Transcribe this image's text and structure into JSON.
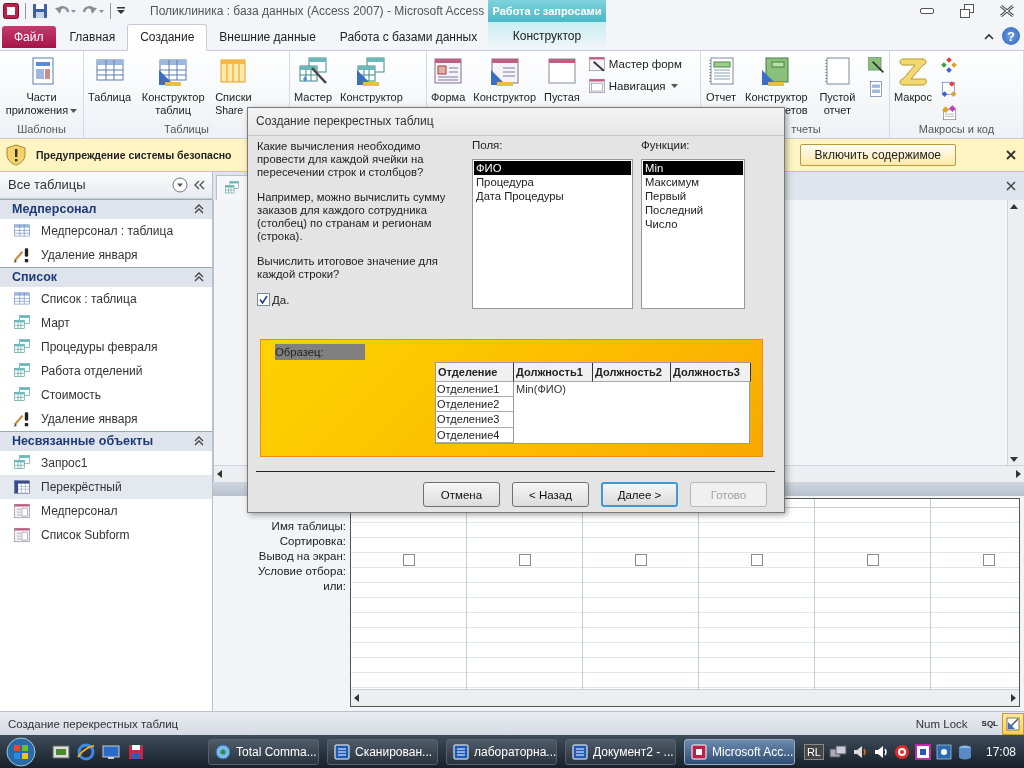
{
  "window": {
    "title": "Поликлиника : база данных (Access 2007)  -  Microsoft Access",
    "context_group": "Работа с запросами"
  },
  "ribbon_tabs": [
    {
      "label": "Файл",
      "kind": "file",
      "selected": false
    },
    {
      "label": "Главная",
      "kind": "tab",
      "selected": false
    },
    {
      "label": "Создание",
      "kind": "tab",
      "selected": true
    },
    {
      "label": "Внешние данные",
      "kind": "tab",
      "selected": false
    },
    {
      "label": "Работа с базами данных",
      "kind": "tab",
      "selected": false
    },
    {
      "label": "Конструктор",
      "kind": "context",
      "selected": false
    }
  ],
  "help": "?",
  "ribbon_groups": [
    {
      "label": "Шаблоны",
      "items": [
        {
          "kind": "large",
          "label": "Части приложения",
          "dropdown": true
        }
      ]
    },
    {
      "label": "Таблицы",
      "items": [
        {
          "kind": "large",
          "label": "Таблица"
        },
        {
          "kind": "large",
          "label": "Конструктор таблиц"
        },
        {
          "kind": "large",
          "label": "Списки",
          "label_line2": "Share"
        }
      ]
    },
    {
      "items": [
        {
          "kind": "large",
          "label": "Мастер"
        },
        {
          "kind": "large",
          "label": "Конструктор"
        }
      ]
    },
    {
      "items": [
        {
          "kind": "large",
          "label": "Форма"
        },
        {
          "kind": "large",
          "label": "Конструктор"
        },
        {
          "kind": "large",
          "label": "Пустая"
        },
        {
          "kind": "stack",
          "items": [
            {
              "label": "Мастер форм"
            },
            {
              "label": "Навигация",
              "dropdown": true
            }
          ]
        }
      ]
    },
    {
      "label": "тчеты",
      "items": [
        {
          "kind": "large",
          "label": "Отчет"
        },
        {
          "kind": "large",
          "label": "Конструктор",
          "label_line2": "етов"
        },
        {
          "kind": "large",
          "label": "Пустой отчет"
        },
        {
          "kind": "icons"
        }
      ]
    },
    {
      "label": "Макросы и код",
      "items": [
        {
          "kind": "large",
          "label": "Макрос"
        },
        {
          "kind": "icons"
        }
      ]
    }
  ],
  "warning": {
    "text": "Предупреждение системы безопасно",
    "button": "Включить содержимое"
  },
  "navigation": {
    "title": "Все таблицы",
    "groups": [
      {
        "label": "Медперсонал",
        "expanded": true,
        "items": [
          {
            "label": "Медперсонал : таблица",
            "kind": "table",
            "selected": false
          },
          {
            "label": "Удаление января",
            "kind": "delete_query",
            "selected": false
          }
        ]
      },
      {
        "label": "Список",
        "expanded": true,
        "items": [
          {
            "label": "Список : таблица",
            "kind": "table",
            "selected": false
          },
          {
            "label": "Март",
            "kind": "query",
            "selected": false
          },
          {
            "label": "Процедуры февраля",
            "kind": "query",
            "selected": false
          },
          {
            "label": "Работа отделений",
            "kind": "query",
            "selected": false
          },
          {
            "label": "Стоимость",
            "kind": "query",
            "selected": false
          },
          {
            "label": "Удаление января",
            "kind": "delete_query",
            "selected": false
          }
        ]
      },
      {
        "label": "Несвязанные объекты",
        "expanded": true,
        "items": [
          {
            "label": "Запрос1",
            "kind": "query",
            "selected": false
          },
          {
            "label": "Перекрёстный",
            "kind": "crosstab",
            "selected": true
          },
          {
            "label": "Медперсонал",
            "kind": "form",
            "selected": false
          },
          {
            "label": "Список Subform",
            "kind": "form",
            "selected": false
          }
        ]
      }
    ]
  },
  "query_grid": {
    "row_labels": [
      "Имя таблицы:",
      "Сортировка:",
      "Вывод на экран:",
      "Условие отбора:",
      "или:"
    ],
    "columns": [
      {
        "show": false
      },
      {
        "show": false
      },
      {
        "show": false
      },
      {
        "show": false
      },
      {
        "show": false
      },
      {
        "show": false
      }
    ]
  },
  "dialog": {
    "title": "Создание перекрестных таблиц",
    "question": "Какие вычисления необходимо провести для каждой ячейки на пересечении строк и столбцов?",
    "example": "Например, можно вычислить сумму заказов для каждого сотрудника (столбец) по странам и регионам (строка).",
    "total_question": "Вычислить итоговое значение для каждой строки?",
    "total_checkbox": {
      "label": "Да.",
      "checked": true
    },
    "fields": {
      "label": "Поля:",
      "items": [
        {
          "label": "ФИО",
          "selected": true
        },
        {
          "label": "Процедура",
          "selected": false
        },
        {
          "label": "Дата Процедуры",
          "selected": false
        }
      ]
    },
    "functions": {
      "label": "Функции:",
      "items": [
        {
          "label": "Min",
          "selected": true
        },
        {
          "label": "Максимум",
          "selected": false
        },
        {
          "label": "Первый",
          "selected": false
        },
        {
          "label": "Последний",
          "selected": false
        },
        {
          "label": "Число",
          "selected": false
        }
      ]
    },
    "sample": {
      "label": "Образец:",
      "columns": [
        "Отделение",
        "Должность1",
        "Должность2",
        "Должность3"
      ],
      "rows": [
        {
          "header": "Отделение1",
          "value": "Min(ФИО)"
        },
        {
          "header": "Отделение2"
        },
        {
          "header": "Отделение3"
        },
        {
          "header": "Отделение4"
        }
      ]
    },
    "buttons": [
      {
        "label": "Отмена",
        "default": false,
        "disabled": false
      },
      {
        "label": "< Назад",
        "default": false,
        "disabled": false
      },
      {
        "label": "Далее >",
        "default": true,
        "disabled": false
      },
      {
        "label": "Готово",
        "default": false,
        "disabled": true
      }
    ]
  },
  "status_bar": {
    "text": "Создание перекрестных таблиц",
    "indicator": "Num Lock",
    "views": [
      {
        "kind": "sql",
        "label": "SQL",
        "selected": false
      },
      {
        "kind": "design",
        "selected": true
      }
    ]
  },
  "taskbar": {
    "tasks": [
      {
        "label": "Total Comma...",
        "kind": "disk",
        "selected": false
      },
      {
        "label": "Сканирован...",
        "kind": "doc",
        "selected": false
      },
      {
        "label": "лабораторна...",
        "kind": "doc",
        "selected": false
      },
      {
        "label": "Документ2 - ...",
        "kind": "doc",
        "selected": false
      },
      {
        "label": "Microsoft Acc...",
        "kind": "app",
        "selected": true
      }
    ],
    "language": "RL",
    "clock": "17:08"
  }
}
